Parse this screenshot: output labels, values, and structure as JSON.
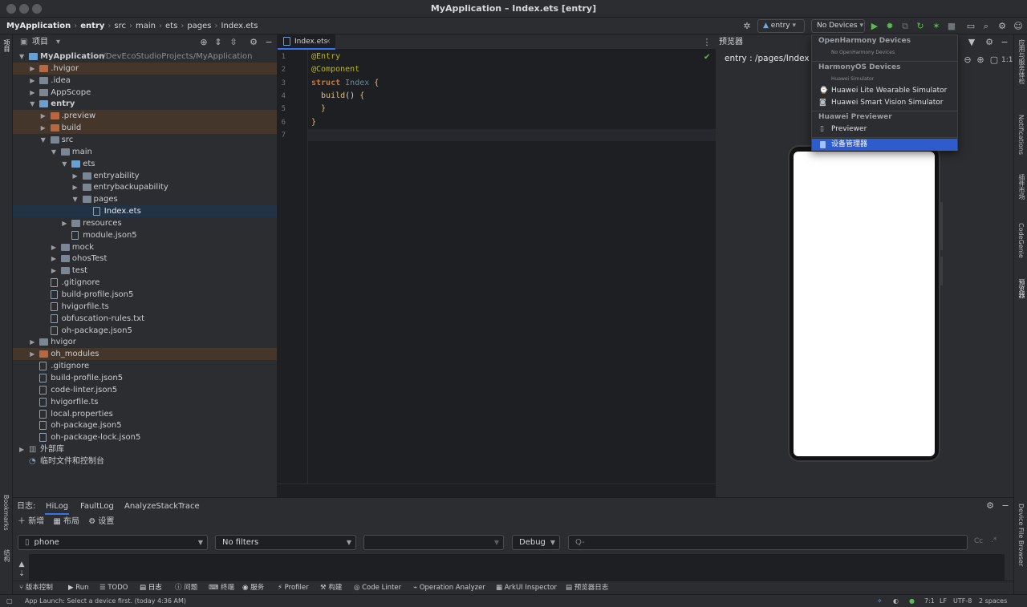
{
  "window": {
    "title": "MyApplication – Index.ets [entry]"
  },
  "breadcrumb": [
    "MyApplication",
    "entry",
    "src",
    "main",
    "ets",
    "pages",
    "Index.ets"
  ],
  "toolbar": {
    "run_config": "entry",
    "device_selector": "No Devices"
  },
  "project_panel": {
    "title": "项目",
    "tree": [
      {
        "label": "MyApplication",
        "hint": "~/DevEcoStudioProjects/MyApplication",
        "depth": 0,
        "arrow": "open",
        "kind": "folder-blue",
        "bold": true
      },
      {
        "label": ".hvigor",
        "depth": 1,
        "arrow": "closed",
        "kind": "folder-orange",
        "excluded": true
      },
      {
        "label": ".idea",
        "depth": 1,
        "arrow": "closed",
        "kind": "folder"
      },
      {
        "label": "AppScope",
        "depth": 1,
        "arrow": "closed",
        "kind": "folder"
      },
      {
        "label": "entry",
        "depth": 1,
        "arrow": "open",
        "kind": "folder-blue",
        "bold": true
      },
      {
        "label": ".preview",
        "depth": 2,
        "arrow": "closed",
        "kind": "folder-orange",
        "excluded": true
      },
      {
        "label": "build",
        "depth": 2,
        "arrow": "closed",
        "kind": "folder-orange",
        "excluded": true
      },
      {
        "label": "src",
        "depth": 2,
        "arrow": "open",
        "kind": "folder"
      },
      {
        "label": "main",
        "depth": 3,
        "arrow": "open",
        "kind": "folder"
      },
      {
        "label": "ets",
        "depth": 4,
        "arrow": "open",
        "kind": "folder-blue"
      },
      {
        "label": "entryability",
        "depth": 5,
        "arrow": "closed",
        "kind": "folder"
      },
      {
        "label": "entrybackupability",
        "depth": 5,
        "arrow": "closed",
        "kind": "folder"
      },
      {
        "label": "pages",
        "depth": 5,
        "arrow": "open",
        "kind": "folder"
      },
      {
        "label": "Index.ets",
        "depth": 6,
        "arrow": "none",
        "kind": "file",
        "selected": true
      },
      {
        "label": "resources",
        "depth": 4,
        "arrow": "closed",
        "kind": "folder"
      },
      {
        "label": "module.json5",
        "depth": 4,
        "arrow": "none",
        "kind": "file"
      },
      {
        "label": "mock",
        "depth": 3,
        "arrow": "closed",
        "kind": "folder"
      },
      {
        "label": "ohosTest",
        "depth": 3,
        "arrow": "closed",
        "kind": "folder"
      },
      {
        "label": "test",
        "depth": 3,
        "arrow": "closed",
        "kind": "folder"
      },
      {
        "label": ".gitignore",
        "depth": 2,
        "arrow": "none",
        "kind": "file"
      },
      {
        "label": "build-profile.json5",
        "depth": 2,
        "arrow": "none",
        "kind": "file"
      },
      {
        "label": "hvigorfile.ts",
        "depth": 2,
        "arrow": "none",
        "kind": "file"
      },
      {
        "label": "obfuscation-rules.txt",
        "depth": 2,
        "arrow": "none",
        "kind": "file"
      },
      {
        "label": "oh-package.json5",
        "depth": 2,
        "arrow": "none",
        "kind": "file"
      },
      {
        "label": "hvigor",
        "depth": 1,
        "arrow": "closed",
        "kind": "folder"
      },
      {
        "label": "oh_modules",
        "depth": 1,
        "arrow": "closed",
        "kind": "folder-orange",
        "excluded": true
      },
      {
        "label": ".gitignore",
        "depth": 1,
        "arrow": "none",
        "kind": "file"
      },
      {
        "label": "build-profile.json5",
        "depth": 1,
        "arrow": "none",
        "kind": "file"
      },
      {
        "label": "code-linter.json5",
        "depth": 1,
        "arrow": "none",
        "kind": "file"
      },
      {
        "label": "hvigorfile.ts",
        "depth": 1,
        "arrow": "none",
        "kind": "file"
      },
      {
        "label": "local.properties",
        "depth": 1,
        "arrow": "none",
        "kind": "file"
      },
      {
        "label": "oh-package.json5",
        "depth": 1,
        "arrow": "none",
        "kind": "file"
      },
      {
        "label": "oh-package-lock.json5",
        "depth": 1,
        "arrow": "none",
        "kind": "file"
      },
      {
        "label": "外部库",
        "depth": 0,
        "arrow": "closed",
        "kind": "library"
      },
      {
        "label": "临时文件和控制台",
        "depth": 0,
        "arrow": "none",
        "kind": "scratch"
      }
    ]
  },
  "editor": {
    "tab": "Index.ets",
    "line_numbers": [
      "1",
      "2",
      "3",
      "4",
      "5",
      "6",
      "7"
    ],
    "lines": [
      [
        {
          "t": "@Entry",
          "c": "anno"
        }
      ],
      [
        {
          "t": "@Component",
          "c": "anno"
        }
      ],
      [
        {
          "t": "struct ",
          "c": "kw"
        },
        {
          "t": "Index ",
          "c": "cls"
        },
        {
          "t": "{",
          "c": "fn"
        }
      ],
      [
        {
          "t": "  build",
          "c": "fn"
        },
        {
          "t": "() ",
          "c": "pun"
        },
        {
          "t": "{",
          "c": "fn"
        }
      ],
      [
        {
          "t": "  }",
          "c": "fn"
        }
      ],
      [
        {
          "t": "}",
          "c": "fn"
        }
      ],
      []
    ]
  },
  "previewer": {
    "title": "预览器",
    "route": "entry : /pages/Index"
  },
  "device_dropdown": {
    "sections": [
      {
        "header": "OpenHarmony Devices",
        "sub": "No OpenHarmony Devices",
        "items": []
      },
      {
        "header": "HarmonyOS Devices",
        "sub": "Huawei Simulator",
        "items": [
          "Huawei Lite Wearable Simulator",
          "Huawei Smart Vision Simulator"
        ]
      },
      {
        "header": "Huawei Previewer",
        "sub": "",
        "items": [
          "Previewer"
        ]
      }
    ],
    "highlighted_item": "设备管理器"
  },
  "log_panel": {
    "label": "日志:",
    "tabs": [
      "HiLog",
      "FaultLog",
      "AnalyzeStackTrace"
    ],
    "actions": [
      "新增",
      "布局",
      "设置"
    ],
    "device": "phone",
    "filter": "No filters",
    "process": "",
    "level": "Debug",
    "search_placeholder": "Q-",
    "cc": "Cc"
  },
  "bottom_tools": [
    "版本控制",
    "Run",
    "TODO",
    "日志",
    "问题",
    "终端",
    "服务",
    "Profiler",
    "构建",
    "Code Linter",
    "Operation Analyzer",
    "ArkUI Inspector",
    "预览器日志"
  ],
  "status_bar": {
    "message": "App Launch: Select a device first. (today 4:36 AM)",
    "position": "7:1",
    "line_sep": "LF",
    "encoding": "UTF-8",
    "indent": "2 spaces"
  },
  "right_strip": [
    "应用与服务体检",
    "Notifications",
    "插件市场",
    "CodeGenie",
    "预览器",
    "Device File Browser"
  ],
  "left_strip": [
    "项目",
    "Bookmarks",
    "结构"
  ]
}
